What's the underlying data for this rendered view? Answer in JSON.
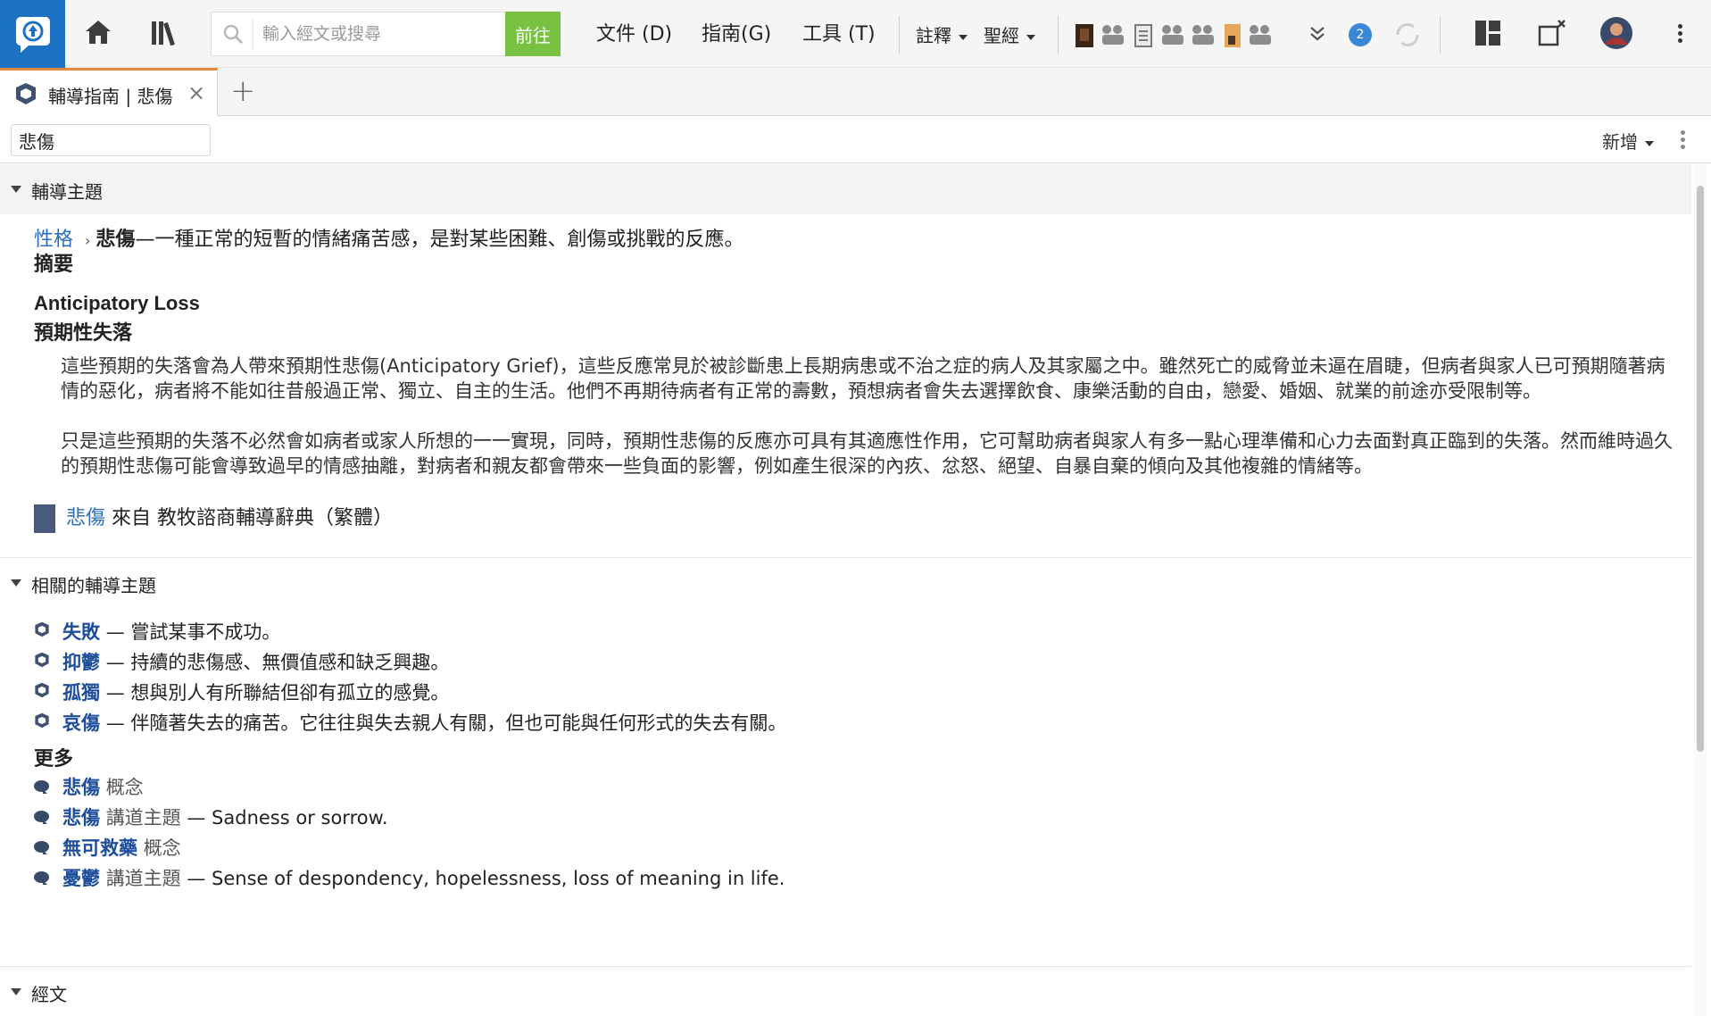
{
  "toolbar": {
    "search_placeholder": "輸入經文或搜尋",
    "go_label": "前往",
    "menu_documents": "文件 (D)",
    "menu_guides": "指南(G)",
    "menu_tools": "工具 (T)",
    "menu_notes": "註釋",
    "menu_bible": "聖經",
    "notification_count": "2"
  },
  "tab": {
    "label": "輔導指南 | 悲傷",
    "close_label": "×",
    "add_label": "+"
  },
  "header": {
    "topic_value": "悲傷",
    "add_label": "新增"
  },
  "sections": {
    "counseling_topics": "輔導主題",
    "related_topics": "相關的輔導主題",
    "scripture": "經文"
  },
  "topic": {
    "breadcrumb_parent": "性格",
    "breadcrumb_sep": "›",
    "term": "悲傷",
    "definition": "—一種正常的短暫的情緒痛苦感，是對某些困難、創傷或挑戰的反應。",
    "summary_heading": "摘要",
    "subheading_en": "Anticipatory Loss",
    "subheading_zh": "預期性失落",
    "paragraph_1": "這些預期的失落會為人帶來預期性悲傷(Anticipatory Grief)，這些反應常見於被診斷患上長期病患或不治之症的病人及其家屬之中。雖然死亡的威脅並未逼在眉睫，但病者與家人已可預期隨著病情的惡化，病者將不能如往昔般過正常、獨立、自主的生活。他們不再期待病者有正常的壽數，預想病者會失去選擇飲食、康樂活動的自由，戀愛、婚姻、就業的前途亦受限制等。",
    "paragraph_2": "只是這些預期的失落不必然會如病者或家人所想的一一實現，同時，預期性悲傷的反應亦可具有其適應性作用，它可幫助病者與家人有多一點心理準備和心力去面對真正臨到的失落。然而維時過久的預期性悲傷可能會導致過早的情感抽離，對病者和親友都會帶來一些負面的影響，例如產生很深的內疚、忿怒、絕望、自暴自棄的傾向及其他複雜的情緒等。",
    "source_term": "悲傷",
    "source_text": "來自 教牧諮商輔導辭典（繁體）"
  },
  "related": [
    {
      "term": "失敗",
      "desc": "— 嘗試某事不成功。"
    },
    {
      "term": "抑鬱",
      "desc": "— 持續的悲傷感、無價值感和缺乏興趣。"
    },
    {
      "term": "孤獨",
      "desc": "— 想與別人有所聯結但卻有孤立的感覺。"
    },
    {
      "term": "哀傷",
      "desc": "— 伴隨著失去的痛苦。它往往與失去親人有關，但也可能與任何形式的失去有關。"
    }
  ],
  "more": {
    "heading": "更多",
    "items": [
      {
        "term": "悲傷",
        "kind": "概念",
        "desc": ""
      },
      {
        "term": "悲傷",
        "kind": "講道主題",
        "desc": "— Sadness or sorrow."
      },
      {
        "term": "無可救藥",
        "kind": "概念",
        "desc": ""
      },
      {
        "term": "憂鬱",
        "kind": "講道主題",
        "desc": "— Sense of despondency, hopelessness, loss of meaning in life."
      }
    ]
  },
  "colors": {
    "brand_blue": "#1e72c4",
    "go_green": "#79c141",
    "tab_accent": "#e8883a",
    "link_blue": "#2a6fc0",
    "term_blue": "#1d4e9c"
  }
}
